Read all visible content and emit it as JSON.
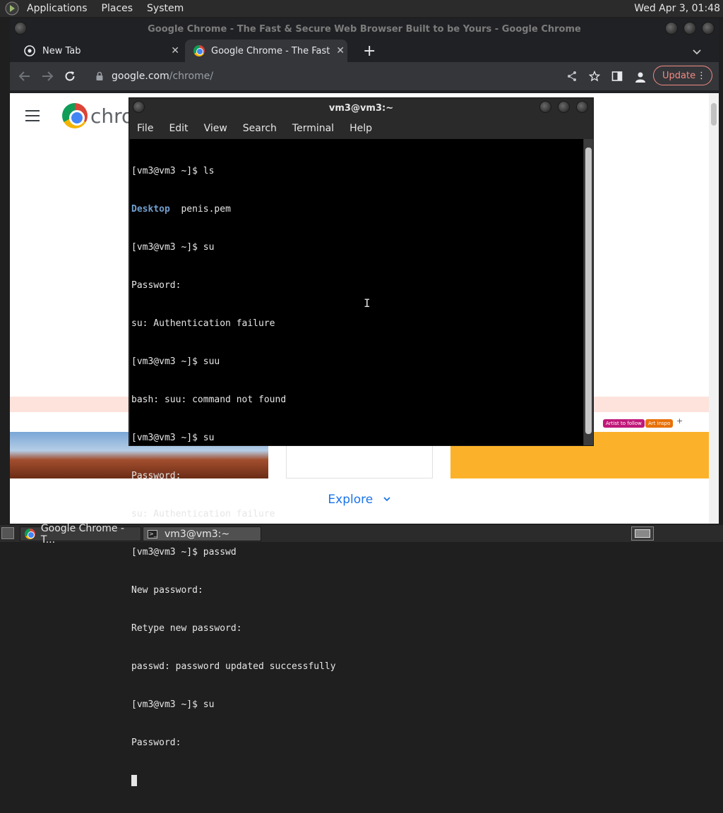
{
  "top_panel": {
    "menus": [
      "Applications",
      "Places",
      "System"
    ],
    "clock": "Wed Apr 3, 01:48"
  },
  "chrome": {
    "window_title": "Google Chrome - The Fast & Secure Web Browser Built to be Yours - Google Chrome",
    "tabs": [
      {
        "label": "New Tab",
        "active": false
      },
      {
        "label": "Google Chrome - The Fast & S",
        "active": true
      }
    ],
    "new_tab_symbol": "+",
    "tab_close_symbol": "✕",
    "url_domain": "google.com",
    "url_path": "/chrome/",
    "update_label": "Update",
    "page": {
      "brand": "chro",
      "chips": [
        "Artist to follow",
        "Art inspo"
      ],
      "chip_colors": [
        "#d93025",
        "#c0187a",
        "#e8710a"
      ],
      "explore_label": "Explore"
    }
  },
  "terminal": {
    "title": "vm3@vm3:~",
    "menus": [
      "File",
      "Edit",
      "View",
      "Search",
      "Terminal",
      "Help"
    ],
    "lines": [
      "[vm3@vm3 ~]$ ls",
      "penis.pem",
      "[vm3@vm3 ~]$ su",
      "Password:",
      "su: Authentication failure",
      "[vm3@vm3 ~]$ suu",
      "bash: suu: command not found",
      "[vm3@vm3 ~]$ su",
      "Password:",
      "su: Authentication failure",
      "[vm3@vm3 ~]$ passwd",
      "New password:",
      "Retype new password:",
      "passwd: password updated successfully",
      "[vm3@vm3 ~]$ su",
      "Password:"
    ],
    "ls_dir_entry": "Desktop"
  },
  "taskbar": {
    "tasks": [
      "Google Chrome - T...",
      "vm3@vm3:~"
    ]
  },
  "colors": {
    "terminal_dir": "#729fcf",
    "update_accent": "#f28b82",
    "link_blue": "#1a73e8"
  }
}
